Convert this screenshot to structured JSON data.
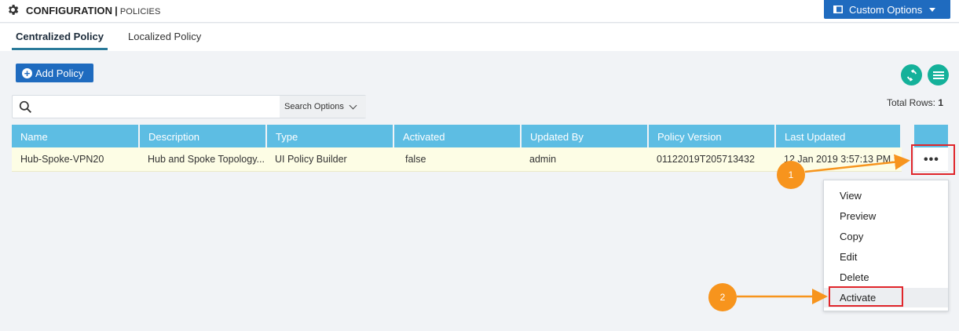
{
  "header": {
    "title": "CONFIGURATION",
    "separator": "|",
    "subtitle": "POLICIES",
    "custom_options_label": "Custom Options"
  },
  "tabs": [
    {
      "label": "Centralized Policy",
      "active": true
    },
    {
      "label": "Localized Policy",
      "active": false
    }
  ],
  "toolbar": {
    "add_policy_label": "Add Policy",
    "search_placeholder": "",
    "search_options_label": "Search Options",
    "total_rows_label": "Total Rows:",
    "total_rows_value": "1"
  },
  "table": {
    "columns": [
      "Name",
      "Description",
      "Type",
      "Activated",
      "Updated By",
      "Policy Version",
      "Last Updated"
    ],
    "rows": [
      {
        "name": "Hub-Spoke-VPN20",
        "description": "Hub and Spoke Topology...",
        "type": "UI Policy Builder",
        "activated": "false",
        "updated_by": "admin",
        "policy_version": "01122019T205713432",
        "last_updated": "12 Jan 2019 3:57:13 PM..."
      }
    ],
    "row_action_label": "•••"
  },
  "context_menu": {
    "items": [
      "View",
      "Preview",
      "Copy",
      "Edit",
      "Delete",
      "Activate"
    ]
  },
  "callouts": [
    "1",
    "2"
  ],
  "colors": {
    "primary_blue": "#1f6bbf",
    "teal": "#14b19a",
    "header_cell": "#5dbde3",
    "row_highlight": "#fdfde5",
    "callout_orange": "#f7941d",
    "annotation_red": "#e0262b"
  }
}
